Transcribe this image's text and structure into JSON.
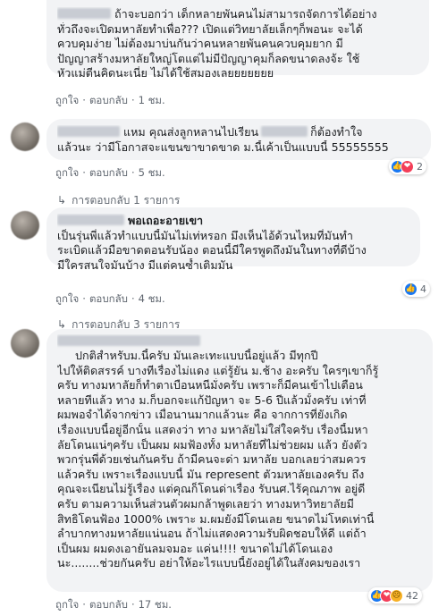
{
  "comments": [
    {
      "name_line_rest": "ถ้าจะบอกว่า เด็กหลายพันคนไม่สามารถจัดการได้อย่าง",
      "lines": [
        "ทั่วถึงจะเปิดมหาลัยทำเพื่อ??? เปิดแต่วิทยาลัยเล็กๆก็พอนะ จะได้",
        "ควบคุมง่าย ไม่ต้องมาบ่นกันว่าคนหลายพันคนควบคุมยาก มี",
        "ปัญญาสร้างมหาลัยใหญ่โตแต่ไม่มีปัญญาคุมก็ลดขนาดลงจ้ะ ใช้",
        "หัวแม่ตีนคิดนะเนี่ย ไม่ได้ใช้สมองเลยยยยยยย"
      ],
      "like": "ถูกใจ",
      "reply": "ตอบกลับ",
      "time": "1 ชม."
    },
    {
      "line1_a": "แหม คุณส่งลูกหลานไปเรียน",
      "line1_b": "ก็ต้องทำใจ",
      "lines": [
        "แล้วนะ ว่ามีโอกาสจะแขนขาขาดขาด ม.นี้เค้าเป็นแบบนี้ 55555555"
      ],
      "like": "ถูกใจ",
      "reply": "ตอบกลับ",
      "time": "5 ชม.",
      "reaction_count": "2",
      "replies_label": "การตอบกลับ 1 รายการ"
    },
    {
      "name": "พอเถอะอายเขา",
      "lines": [
        "เป็นรุ่นพี่แล้วทำแบบนี้มันไม่เท่หรอก มึงเห็นไอ้ด้วนไหมที่มันทำ",
        "ระเบิดแล้วมือขาดตอนรับน้อง ตอนนี้มีใครพูดถึงมันในทางที่ดีบ้าง",
        "มีใครสนใจมันบ้าง มีแต่คนซ้ำเติมมัน"
      ],
      "like": "ถูกใจ",
      "reply": "ตอบกลับ",
      "time": "4 ชม.",
      "reaction_count": "4",
      "replies_label": "การตอบกลับ 3 รายการ"
    },
    {
      "lines": [
        "ปกติสำหรับม.นี้ครับ มันเละเทะแบบนี้อยู่แล้ว มีทุกปี",
        "ไปให้ติดสรรค์ บางทีเรื่องไม่แดง แต่รู้ยัน ม.ช้าง อะครับ ใครๆเขาก็รู้",
        "ครับ ทางมหาลัยก็ทำตาเบือนหนีมั่งครับ เพราะก็มีคนเข้าไปเตือน",
        "หลายทีแล้ว ทาง ม.ก็บอกจะแก้ปัญหา จะ 5-6 ปีแล้วมั้งครับ เท่าที่",
        "ผมพอจำได้จากข่าว เมื่อนานมากแล้วนะ คือ จากการที่ยังเกิด",
        "เรื่องแบบนี้อยู่อีกนั้น แสดงว่า ทาง มหาลัยไม่ใส่ใจครับ เรื่องนี้มหา",
        "ลัยโดนแน่ๆครับ เป็นผม ผมฟ้องทั้ง มหาลัยที่ไม่ช่วยผม แล้ว ยังตัว",
        "พวกรุ่นพี่ด้วยเช่นกันครับ ถ้ามีคนจะด่า มหาลัย บอกเลยว่าสมควร",
        "แล้วครับ เพราะเรื่องแบบนี้ มัน represent ตัวมหาลัยเองครับ ถึง",
        "คุณจะเนียนไม่รู้เรื่อง แต่คุณก็โดนด่าเรื่อง รับนศ.ไร้คุณภาพ อยู่ดี",
        "ครับ ตามความเห็นส่วนตัวผมกล้าพูดเลยว่า ทางมหาวิทยาลัยมี",
        "สิทธิโดนฟ้อง 1000% เพราะ ม.ผมยังมีโดนเลย ขนาดไม่โหดเท่านี้",
        "ลำบากทางมหาลัยแน่นอน ถ้าไม่แสดงความรับผิดชอบให้ดี แต่ถ้า",
        "เป็นผม ผมดงเอายันลมจมอะ แค่น!!!! ขนาดไม่ได้โดนเอง",
        "นะ........ช่วยกันครับ อย่าให้อะไรแบบนี้ยังอยู่ได้ในสังคมของเรา"
      ],
      "like": "ถูกใจ",
      "reply": "ตอบกลับ",
      "time": "17 ชม.",
      "reaction_count": "42"
    }
  ],
  "colors": {
    "bubble": "#f2f3f5",
    "meta": "#606770",
    "like": "#1877f2",
    "love": "#f33e58",
    "sad": "#f7b125"
  },
  "icons": {
    "like": "thumbs-up-icon",
    "love": "heart-icon",
    "sad": "sad-face-icon",
    "reply_arrow": "reply-arrow-icon"
  }
}
